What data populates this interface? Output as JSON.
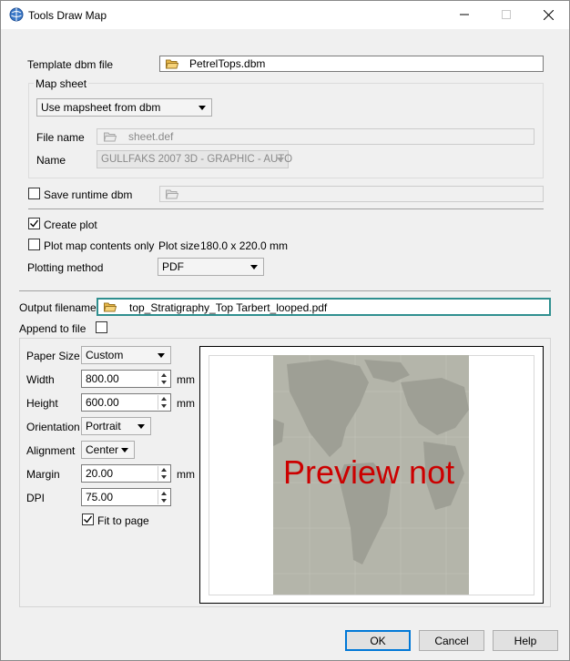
{
  "window": {
    "title": "Tools Draw Map"
  },
  "template": {
    "label": "Template dbm file",
    "value": "PetrelTops.dbm"
  },
  "map_sheet": {
    "group_label": "Map sheet",
    "mode": "Use mapsheet from dbm",
    "file_name_label": "File name",
    "file_name_value": "sheet.def",
    "name_label": "Name",
    "name_value": "GULLFAKS 2007 3D - GRAPHIC - AUTO"
  },
  "runtime": {
    "label": "Save runtime dbm",
    "checked": false
  },
  "create_plot": {
    "label": "Create plot",
    "checked": true
  },
  "plot_contents": {
    "label": "Plot map contents only",
    "checked": false
  },
  "plot_size": {
    "label": "Plot size",
    "value": "180.0 x 220.0 mm"
  },
  "plotting_method": {
    "label": "Plotting method",
    "value": "PDF"
  },
  "output": {
    "label": "Output filename",
    "value": "top_Stratigraphy_Top Tarbert_looped.pdf"
  },
  "append": {
    "label": "Append to file",
    "checked": false
  },
  "page_setup": {
    "paper_size_label": "Paper Size",
    "paper_size": "Custom",
    "width_label": "Width",
    "width": "800.00",
    "width_unit": "mm",
    "height_label": "Height",
    "height": "600.00",
    "height_unit": "mm",
    "orientation_label": "Orientation",
    "orientation": "Portrait",
    "alignment_label": "Alignment",
    "alignment": "Center",
    "margin_label": "Margin",
    "margin": "20.00",
    "margin_unit": "mm",
    "dpi_label": "DPI",
    "dpi": "75.00",
    "fit_label": "Fit to page",
    "fit_checked": true
  },
  "preview": {
    "text": "Preview not",
    "text_color": "#cc0000",
    "paper_color": "#b4b5aa"
  },
  "buttons": {
    "ok": "OK",
    "cancel": "Cancel",
    "help": "Help"
  },
  "colors": {
    "accent": "#0078d7",
    "output_border": "#2f8f8f"
  }
}
